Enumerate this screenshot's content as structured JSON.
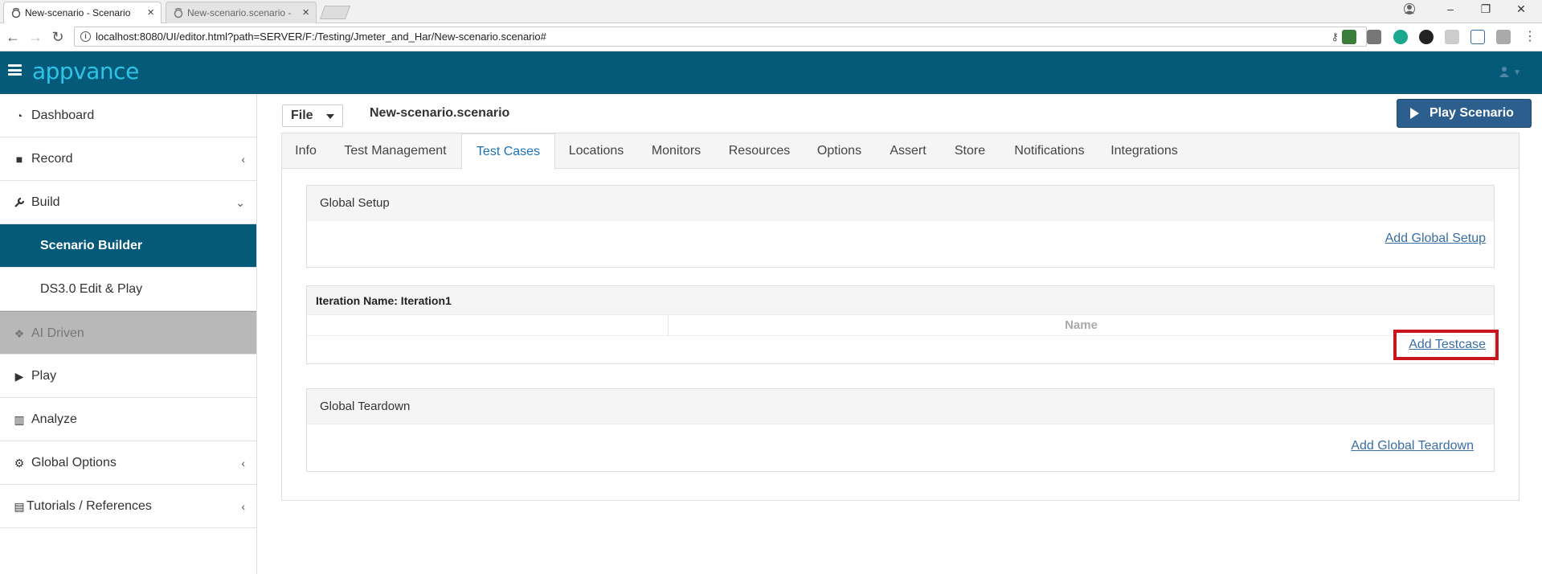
{
  "browser": {
    "tabs": [
      {
        "label": "New-scenario - Scenario",
        "active": true
      },
      {
        "label": "New-scenario.scenario -",
        "active": false
      }
    ],
    "url": "localhost:8080/UI/editor.html?path=SERVER/F:/Testing/Jmeter_and_Har/New-scenario.scenario#",
    "window_controls": {
      "minimize": "–",
      "restore": "❐",
      "close": "✕"
    }
  },
  "app": {
    "logo": "appvance",
    "colors": {
      "header": "#055a7a",
      "accent": "#2ec4e6",
      "play_button": "#2c5f8d",
      "highlight": "#c9151e"
    }
  },
  "sidebar": {
    "items": [
      {
        "label": "Dashboard",
        "icon": "dashboard-icon",
        "glyph": "◔",
        "chevron": ""
      },
      {
        "label": "Record",
        "icon": "video-camera-icon",
        "glyph": "■",
        "chevron": "‹"
      },
      {
        "label": "Build",
        "icon": "wrench-icon",
        "glyph": "🔧",
        "chevron": "⌄"
      },
      {
        "label": "Scenario Builder",
        "icon": "",
        "glyph": "",
        "chevron": ""
      },
      {
        "label": "DS3.0 Edit & Play",
        "icon": "",
        "glyph": "",
        "chevron": ""
      },
      {
        "label": "AI Driven",
        "icon": "cubes-icon",
        "glyph": "❖",
        "chevron": ""
      },
      {
        "label": "Play",
        "icon": "play-icon",
        "glyph": "▶",
        "chevron": ""
      },
      {
        "label": "Analyze",
        "icon": "bar-chart-icon",
        "glyph": "▥",
        "chevron": ""
      },
      {
        "label": "Global Options",
        "icon": "cogs-icon",
        "glyph": "⚙",
        "chevron": "‹"
      },
      {
        "label": "Tutorials / References",
        "icon": "book-icon",
        "glyph": "▤",
        "chevron": "‹"
      }
    ]
  },
  "editor": {
    "file_menu": "File",
    "scenario_name": "New-scenario.scenario",
    "play_button": "Play Scenario",
    "tabs": [
      "Info",
      "Test Management",
      "Test Cases",
      "Locations",
      "Monitors",
      "Resources",
      "Options",
      "Assert",
      "Store",
      "Notifications",
      "Integrations"
    ],
    "active_tab": "Test Cases",
    "global_setup": {
      "title": "Global Setup",
      "link": "Add Global Setup"
    },
    "iteration": {
      "title": "Iteration Name: Iteration1",
      "column": "Name",
      "link": "Add Testcase"
    },
    "global_teardown": {
      "title": "Global Teardown",
      "link": "Add Global Teardown"
    }
  }
}
